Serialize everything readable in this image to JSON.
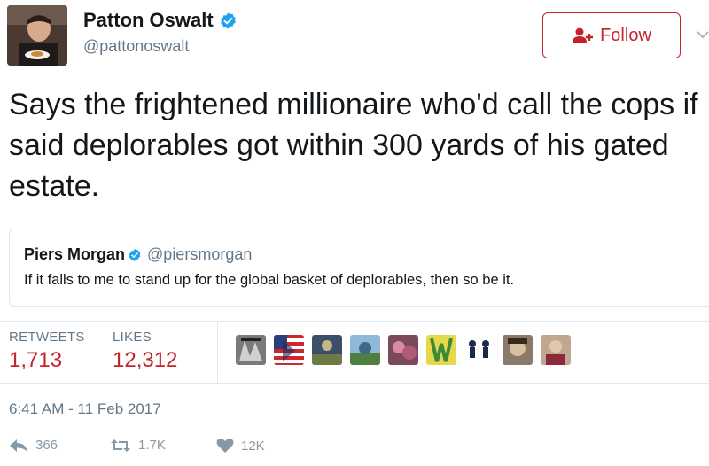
{
  "author": {
    "display_name": "Patton Oswalt",
    "handle": "@pattonoswalt",
    "verified": true
  },
  "follow_button": {
    "label": "Follow",
    "icon": "add-user-icon"
  },
  "tweet": {
    "text": "Says the frightened millionaire who'd call the cops if said deplorables got within 300 yards of his gated estate."
  },
  "quoted_tweet": {
    "display_name": "Piers Morgan",
    "handle": "@piersmorgan",
    "verified": true,
    "text": "If it falls to me to stand up for the global basket of deplorables, then so be it."
  },
  "stats": {
    "retweets_label": "RETWEETS",
    "retweets_value": "1,713",
    "likes_label": "LIKES",
    "likes_value": "12,312"
  },
  "likers": [
    "liker-1",
    "liker-2",
    "liker-3",
    "liker-4",
    "liker-5",
    "liker-6",
    "liker-7",
    "liker-8",
    "liker-9"
  ],
  "timestamp": "6:41 AM - 11 Feb 2017",
  "actions": {
    "reply_count": "366",
    "retweet_count": "1.7K",
    "like_count": "12K"
  },
  "colors": {
    "accent": "#c4232d",
    "verified": "#1da1f2",
    "muted": "#657786",
    "action": "#8899a6"
  }
}
